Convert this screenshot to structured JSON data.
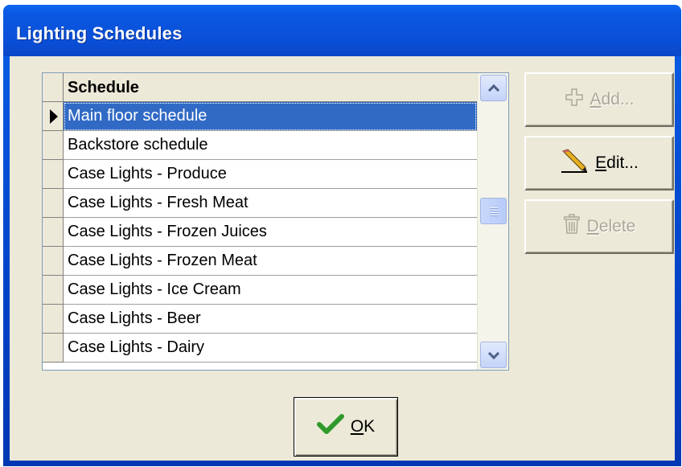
{
  "window": {
    "title": "Lighting Schedules"
  },
  "grid": {
    "header": "Schedule",
    "rows": [
      "Main floor schedule",
      "Backstore schedule",
      "Case Lights - Produce",
      "Case Lights - Fresh Meat",
      "Case Lights - Frozen Juices",
      "Case Lights - Frozen Meat",
      "Case Lights - Ice Cream",
      "Case Lights - Beer",
      "Case Lights - Dairy"
    ],
    "selected_row": 0,
    "scroll_position": 0.45
  },
  "buttons": {
    "add": {
      "label": "Add...",
      "enabled": false,
      "icon": "plus-icon"
    },
    "edit": {
      "label": "Edit...",
      "enabled": true,
      "icon": "pencil-icon"
    },
    "delete": {
      "label": "Delete",
      "enabled": false,
      "icon": "trash-icon"
    },
    "ok": {
      "label": "OK",
      "icon": "checkmark-icon"
    }
  },
  "colors": {
    "titlebar": "#0a50d8",
    "selection": "#316ac5",
    "dialog_face": "#ece9d8",
    "ok_check": "#2e9a2a"
  }
}
